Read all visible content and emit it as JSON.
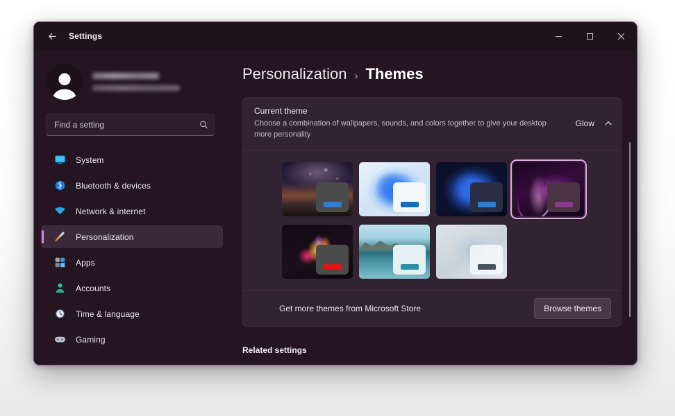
{
  "window": {
    "app_title": "Settings",
    "back_icon": "back-arrow-icon",
    "controls": {
      "minimize": "minimize-icon",
      "maximize": "maximize-icon",
      "close": "close-icon"
    },
    "border_color": "#7b3f86",
    "background_color": "#241520"
  },
  "account": {
    "name": "",
    "email": "",
    "redacted": true,
    "avatar_icon": "user-avatar-icon"
  },
  "search": {
    "placeholder": "Find a setting",
    "value": "",
    "icon": "search-icon"
  },
  "sidebar": {
    "items": [
      {
        "label": "System",
        "icon": "display-monitor-icon",
        "selected": false
      },
      {
        "label": "Bluetooth & devices",
        "icon": "bluetooth-icon",
        "selected": false
      },
      {
        "label": "Network & internet",
        "icon": "wifi-icon",
        "selected": false
      },
      {
        "label": "Personalization",
        "icon": "paintbrush-icon",
        "selected": true
      },
      {
        "label": "Apps",
        "icon": "apps-grid-icon",
        "selected": false
      },
      {
        "label": "Accounts",
        "icon": "account-person-icon",
        "selected": false
      },
      {
        "label": "Time & language",
        "icon": "clock-icon",
        "selected": false
      },
      {
        "label": "Gaming",
        "icon": "game-controller-icon",
        "selected": false
      }
    ],
    "accent_color": "#e17fd2",
    "selected_background": "#3b2a3c"
  },
  "breadcrumb": {
    "parent": "Personalization",
    "separator": "›",
    "current": "Themes"
  },
  "current_theme_card": {
    "title": "Current theme",
    "description": "Choose a combination of wallpapers, sounds, and colors together to give your desktop more personality",
    "value": "Glow",
    "chevron_icon": "chevron-up-icon",
    "expanded": true,
    "background_color": "#322333"
  },
  "themes": [
    {
      "name": "milky-way-landscape",
      "art": "art-milkyway",
      "mini": "dark",
      "accent_color": "#2b7fd4",
      "selected": false
    },
    {
      "name": "windows-bloom-light",
      "art": "art-bloom-light",
      "mini": "light",
      "accent_color": "#0f6cbd",
      "selected": false
    },
    {
      "name": "windows-bloom-dark",
      "art": "art-bloom-dark",
      "mini": "dark2",
      "accent_color": "#2b7fd4",
      "selected": false
    },
    {
      "name": "glow",
      "art": "art-glow",
      "mini": "dark3",
      "accent_color": "#8b3a8f",
      "selected": true
    },
    {
      "name": "dark-floral",
      "art": "art-floral",
      "mini": "dark",
      "accent_color": "#e11414",
      "selected": false
    },
    {
      "name": "lake-landscape",
      "art": "art-lake",
      "mini": "lightt",
      "accent_color": "#2e8ea3",
      "selected": false
    },
    {
      "name": "flow-ribbons",
      "art": "art-ribbon",
      "mini": "glass",
      "accent_color": "#475260",
      "selected": false
    }
  ],
  "store_row": {
    "text": "Get more themes from Microsoft Store",
    "button_label": "Browse themes"
  },
  "related_settings": {
    "heading": "Related settings"
  },
  "scrollbar": {
    "visible": true
  }
}
